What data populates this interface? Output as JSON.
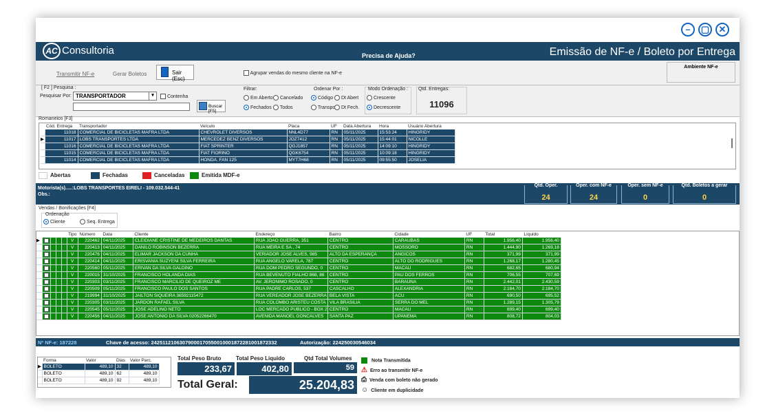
{
  "window": {
    "minimize": "–",
    "maximize": "▢",
    "close": "✕"
  },
  "header": {
    "logo": "AC",
    "brand": "Consultoria",
    "help": "Precisa de Ajuda?",
    "title": "Emissão de NF-e / Boleto por Entrega"
  },
  "toolbar": {
    "transmitir": "Transmitir NF-e",
    "gerar": "Gerar Boletos",
    "sair": "Sair (Esc)",
    "agrupar": "Agrupar vendas do mesmo cliente na NF-e",
    "ambiente": "Ambiente NF-e"
  },
  "search": {
    "section_label": "[ F2 ] Pesquisa :",
    "pesquisar_por_label": "Pesquisar Por:",
    "pesquisar_por_value": "TRANSPORTADOR",
    "contenha": "Contenha",
    "buscar": "Buscar [F5]",
    "filtrar_label": "Filtrar:",
    "em_aberto": "Em Aberto",
    "cancelado": "Cancelado",
    "fechados": "Fechados",
    "todos": "Todos",
    "ordenar_label": "Ordenar Por :",
    "codigo": "Código",
    "dt_abert": "Dt Abert",
    "transpo": "Transpo",
    "dt_fech": "Dt Fech.",
    "modo_label": "Modo Ordenação :",
    "crescente": "Crescente",
    "decrescente": "Decrescente",
    "qtd_label": "Qtd. Entregas:",
    "qtd_value": "11096"
  },
  "romaneios": {
    "label": "Romaneios [F3]",
    "headers": [
      "Cód. Entrega",
      "Transportador",
      "Veículo",
      "Placa",
      "UF",
      "Data Abertura",
      "Hora",
      "Usuário Abertura"
    ],
    "rows": [
      [
        "11018",
        "COMERCIAL DE BICICLETAS MAFRA LTDA",
        "CHEVROLET DIVERSOS",
        "NNL4D77",
        "RN",
        "05/11/2025",
        "15:53:24",
        "HINGRIDY"
      ],
      [
        "11017",
        "LOBS TRANSPORTES LTDA",
        "MERCEDEZ BENZ DIVERSOS",
        "JOZ7412",
        "RN",
        "05/11/2025",
        "15:44:01",
        "NICOLLE"
      ],
      [
        "11016",
        "COMERCIAL DE BICICLETAS MAFRA LTDA",
        "FIAT SPRINTER",
        "QGJ1857",
        "RN",
        "05/11/2025",
        "14:09:10",
        "HINGRIDY"
      ],
      [
        "11015",
        "COMERCIAL DE BICICLETAS MAFRA LTDA",
        "FIAT FIORINO",
        "QGK6754",
        "RN",
        "05/11/2025",
        "10:09:18",
        "HINGRIDY"
      ],
      [
        "11014",
        "COMERCIAL DE BICICLETAS MAFRA LTDA",
        "HONDA. FAN 125",
        "MYT7H68",
        "RN",
        "05/11/2025",
        "09:55:50",
        "JOSELIA"
      ]
    ]
  },
  "legend": {
    "abertas": "Abertas",
    "fechadas": "Fechadas",
    "canceladas": "Canceladas",
    "mdfe": "Emitida MDF-e"
  },
  "motorista": {
    "line1": "Motorista(s).....:LOBS TRANSPORTES EIRELI - 109.032.544-41",
    "line2": "Obs.:"
  },
  "qtds": [
    {
      "label": "Qtd. Oper.",
      "value": "24"
    },
    {
      "label": "Oper. com NF-e",
      "value": "24"
    },
    {
      "label": "Oper. sem NF-e",
      "value": "0"
    },
    {
      "label": "Qtd. Boletos a gerar",
      "value": "0"
    }
  ],
  "vendas": {
    "label": "Vendas / Bonificações [F4]",
    "ordenacao": "Ordenação",
    "cliente": "Cliente",
    "seq": "Seq. Entrega",
    "headers": [
      "Tipo",
      "Número",
      "Data",
      "Cliente",
      "Endereço",
      "Bairro",
      "Cidade",
      "UF",
      "Total",
      "Líquido"
    ],
    "rows": [
      [
        "V",
        "220462",
        "04/11/2025",
        "CLEIDIANE CRISTINE DE MEDEIROS DANTAS",
        "RUA JOAO GUERRA, 351",
        "CENTRO",
        "CARAUBAS",
        "RN",
        "1.956,40",
        "1.956,40"
      ],
      [
        "V",
        "220413",
        "04/11/2025",
        "DANILO ROBINSON BEZERRA",
        "RUA MEIRA E SA , 74",
        "CENTRO",
        "MOSSORO",
        "RN",
        "1.444,90",
        "1.269,18"
      ],
      [
        "V",
        "220476",
        "04/11/2025",
        "ELIMAR JACKSON DA CUNHA",
        "VERIADOR JOSE ALVES, 985",
        "ALTO DA ESPERANÇA",
        "ANGICOS",
        "RN",
        "371,99",
        "371,99"
      ],
      [
        "V",
        "220414",
        "04/11/2025",
        "ERISVANIA SUZYENI SILVA FERREIRA",
        "RUA ANGELO VARELA, 787",
        "CENTRO",
        "ALTO DO RODRIGUES",
        "RN",
        "1.268,17",
        "1.280,45"
      ],
      [
        "V",
        "220560",
        "05/11/2025",
        "ERIVAN DA SILVA GALDINO",
        "RUA DOM PEDRO SEGUNDO, 0",
        "CENTRO",
        "MACAU",
        "RN",
        "682,65",
        "680,94"
      ],
      [
        "V",
        "220015",
        "31/10/2025",
        "FRANCISCO HOLANDA DIAS",
        "RUA BEVENUTO FIALHO 868, 86",
        "CENTRO",
        "PAU DOS FERROS",
        "RN",
        "706,55",
        "707,69"
      ],
      [
        "V",
        "220303",
        "03/11/2025",
        "FRANCISCO MARCILIO DE QUEIROZ ME",
        "AV. JERONIMO ROSADO, 0",
        "CENTRO",
        "BARAUNA",
        "RN",
        "2.442,01",
        "2.430,59"
      ],
      [
        "V",
        "220509",
        "05/11/2025",
        "FRANCISCO PAULO DOS SANTOS",
        "RUA PADRE CARLOS, 537",
        "CASCALHO",
        "ALEXANDRIA",
        "RN",
        "2.184,70",
        "2.184,70"
      ],
      [
        "V",
        "219994",
        "31/10/2025",
        "JAILTON SIQUEIRA 36592115472",
        "RUA VEREADOR JOSE BEZERRA",
        "BELA VISTA",
        "ACU",
        "RN",
        "690,50",
        "695,52"
      ],
      [
        "V",
        "220305",
        "03/11/2025",
        "JARDON RAFAEL SILVA",
        "RUA COLOMBO ARISTEU COSTA",
        "VILA BRASILIA",
        "SERRA DO MEL",
        "RN",
        "1.289,15",
        "1.305,79"
      ],
      [
        "V",
        "220545",
        "05/11/2025",
        "JOSE ADELINO NETO",
        "LOC MERCADO PUBLICO - BOX 2",
        "CENTRO",
        "MACAU",
        "RN",
        "699,40",
        "699,40"
      ],
      [
        "V",
        "220456",
        "04/11/2025",
        "JOSE ANTONIO DA SILVA 02052266470",
        "AVENIDA MANOEL GONCALVES",
        "SANTA PAZ",
        "UPANEMA",
        "RN",
        "808,72",
        "804,03"
      ]
    ]
  },
  "nfe": {
    "numero": "Nº NF-e: 187228",
    "chave": "Chave de acesso: 24251121063079000170550010001872281001872332",
    "autorizacao": "Autorização: 224250030546034"
  },
  "pagto": {
    "headers": [
      "Forma",
      "Valor",
      "Dias",
      "Valor Parc."
    ],
    "rows": [
      [
        "BOLETO",
        "489,10",
        "32",
        "489,10"
      ],
      [
        "BOLETO",
        "489,10",
        "62",
        "489,10"
      ],
      [
        "BOLETO",
        "489,10",
        "92",
        "489,10"
      ]
    ]
  },
  "totals": {
    "peso_bruto_label": "Total Peso Bruto",
    "peso_bruto": "233,67",
    "peso_liquido_label": "Total Peso Liquido",
    "peso_liquido": "402,80",
    "volumes_label": "Qtd Total Volumes",
    "volumes": "59",
    "geral_label": "Total Geral:",
    "geral": "25.204,83"
  },
  "legend2": {
    "nota": "Nota Transmitida",
    "erro": "Erro ao transmitir NF-e",
    "boleto": "Venda com boleto não gerado",
    "dup": "Cliente em duplicidade"
  },
  "colors": {
    "navy": "#1d4766",
    "green": "#0d8a0d",
    "red": "#e02020",
    "yellow": "#ffd54a"
  }
}
